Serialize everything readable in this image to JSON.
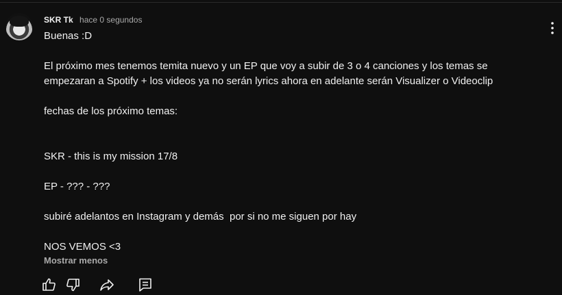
{
  "comment": {
    "author": "SKR Tk",
    "time": "hace 0 segundos",
    "lines": {
      "l1": "Buenas :D",
      "l2": "El próximo mes tenemos temita nuevo y un EP que voy a subir de 3 o 4 canciones y los temas se",
      "l3": "empezaran a Spotify + los videos ya no serán lyrics ahora en adelante serán Visualizer o Videoclip",
      "l4": "fechas de los próximo temas:",
      "l5": "SKR - this is my mission 17/8",
      "l6": "EP - ??? - ???",
      "l7": "subiré adelantos en Instagram y demás  por si no me siguen por hay",
      "l8": "NOS VEMOS <3"
    },
    "show_less": "Mostrar menos"
  },
  "icons": {
    "like": "thumb-up-icon",
    "dislike": "thumb-down-icon",
    "share": "share-icon",
    "reply": "reply-icon",
    "menu": "more-vertical-icon"
  },
  "colors": {
    "background": "#0f0f0f",
    "text": "#f1f1f1",
    "secondary": "#aaaaaa"
  }
}
